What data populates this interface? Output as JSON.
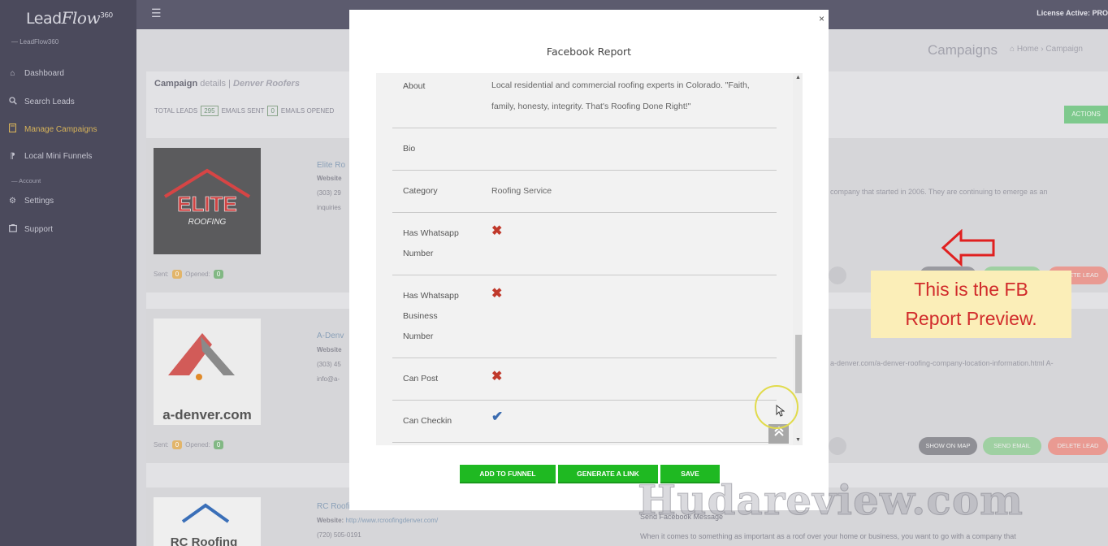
{
  "sidebar": {
    "logo_main": "Lead",
    "logo_script": "Flow",
    "logo_sup": "360",
    "sub_brand": "— LeadFlow360",
    "items": [
      {
        "label": "Dashboard",
        "icon": "home-icon"
      },
      {
        "label": "Search Leads",
        "icon": "search-icon"
      },
      {
        "label": "Manage Campaigns",
        "icon": "book-icon"
      },
      {
        "label": "Local Mini Funnels",
        "icon": "funnel-icon"
      }
    ],
    "section_account": "— Account",
    "account_items": [
      {
        "label": "Settings",
        "icon": "gear-icon"
      },
      {
        "label": "Support",
        "icon": "support-icon"
      }
    ]
  },
  "topbar": {
    "license": "License Active: PRO"
  },
  "page": {
    "title": "Campaigns",
    "breadcrumb_home": "Home",
    "breadcrumb_current": "Campaign",
    "campaign_label": "Campaign",
    "details_label": "details |",
    "campaign_name": "Denver Roofers",
    "total_leads_label": "TOTAL LEADS",
    "total_leads": "295",
    "emails_sent_label": "EMAILS SENT",
    "emails_sent": "0",
    "emails_opened_label": "EMAILS OPENED",
    "actions_label": "ACTIONS"
  },
  "leads": [
    {
      "name": "Elite Ro",
      "website_label": "Website",
      "phone": "(303) 29",
      "extra": "inquiries",
      "sent_label": "Sent:",
      "sent": "0",
      "opened_label": "Opened:",
      "opened": "0",
      "logo_text": "ELITE",
      "logo_sub": "ROOFING",
      "desc": "company that started in 2006. They are continuing to emerge as an"
    },
    {
      "name": "A-Denv",
      "website_label": "Website",
      "phone": "(303) 45",
      "extra": "info@a-",
      "sent_label": "Sent:",
      "sent": "0",
      "opened_label": "Opened:",
      "opened": "0",
      "logo_text": "a-denver.com",
      "desc": "a-denver.com/a-denver-roofing-company-location-information.html A-",
      "show_on_map": "SHOW ON MAP",
      "send_email": "SEND EMAIL",
      "delete_lead": "DELETE LEAD"
    },
    {
      "name": "RC Roofi",
      "website_label": "Website:",
      "website": "http://www.rcroofingdenver.com/",
      "phone": "(720) 505-0191",
      "logo_text": "RC Roofing",
      "send_fb": "Send Facebook Message",
      "desc": "When it comes to something as important as a roof over your home or business, you want to go with a company that"
    }
  ],
  "bg_buttons": {
    "delete_lead": "DELETE LEAD",
    "send_email": "SEND EMAIL"
  },
  "modal": {
    "title": "Facebook Report",
    "close": "×",
    "rows": [
      {
        "label": "About",
        "value": "Local residential and commercial roofing experts in Colorado. \"Faith, family, honesty, integrity. That's Roofing Done Right!\""
      },
      {
        "label": "Bio",
        "value": ""
      },
      {
        "label": "Category",
        "value": "Roofing Service"
      },
      {
        "label": "Has Whatsapp Number",
        "value": "no"
      },
      {
        "label": "Has Whatsapp Business Number",
        "value": "no"
      },
      {
        "label": "Can Post",
        "value": "no"
      },
      {
        "label": "Can Checkin",
        "value": "yes"
      }
    ],
    "label_lines": {
      "wa1": "Has Whatsapp",
      "wa2": "Number",
      "wab1": "Has Whatsapp",
      "wab2": "Business",
      "wab3": "Number"
    },
    "buttons": {
      "add_to_funnel": "ADD TO FUNNEL",
      "generate_link": "GENERATE A LINK",
      "save": "SAVE"
    }
  },
  "annotation": {
    "callout": "This is the FB Report Preview.",
    "callout_line1": "This is the FB",
    "callout_line2": "Report Preview.",
    "watermark": "Hudareview.com"
  },
  "colors": {
    "sidebar_bg": "#4b4a5c",
    "active_nav": "#d7b35a",
    "button_green": "#1fb922",
    "x_red": "#c0392b",
    "check_blue": "#3b6cb0",
    "callout_bg": "#fbeeb8",
    "callout_text": "#d12b2b"
  }
}
